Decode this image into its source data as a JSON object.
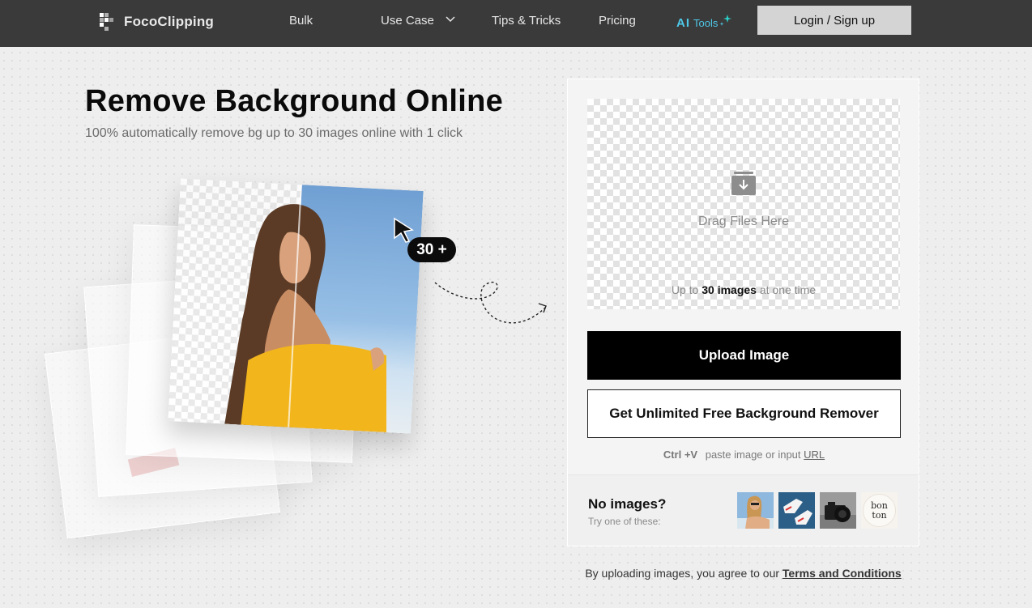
{
  "header": {
    "logo_text": "FocoClipping",
    "nav": {
      "bulk": "Bulk",
      "use_case": "Use Case",
      "tips": "Tips & Tricks",
      "pricing": "Pricing"
    },
    "ai_tools": {
      "ai": "AI",
      "tools": "Tools"
    },
    "login_label": "Login / Sign up"
  },
  "hero": {
    "title": "Remove Background Online",
    "subtitle": "100% automatically remove bg up to 30 images online with 1 click",
    "badge": "30 +"
  },
  "upload": {
    "drag_text": "Drag Files Here",
    "limit_prefix": "Up to",
    "limit_bold": "30 images",
    "limit_suffix": "at one time",
    "upload_label": "Upload Image",
    "unlimited_label": "Get Unlimited Free Background Remover",
    "paste_kbd": "Ctrl +V",
    "paste_text": "paste image or input",
    "paste_url": "URL"
  },
  "samples": {
    "title": "No images?",
    "hint": "Try one of these:",
    "items": [
      "woman-photo",
      "sneakers-photo",
      "camera-photo",
      "bonton-logo"
    ],
    "logo_text": "bon ton"
  },
  "legal": {
    "prefix": "By uploading images, you agree to our",
    "link": "Terms and Conditions"
  },
  "colors": {
    "header_bg": "#3a3a3a",
    "accent_ai": "#4fc8e8",
    "primary_button": "#000000",
    "photo_sky": "#7aa9d8",
    "cloth_yellow": "#f2b51c"
  }
}
